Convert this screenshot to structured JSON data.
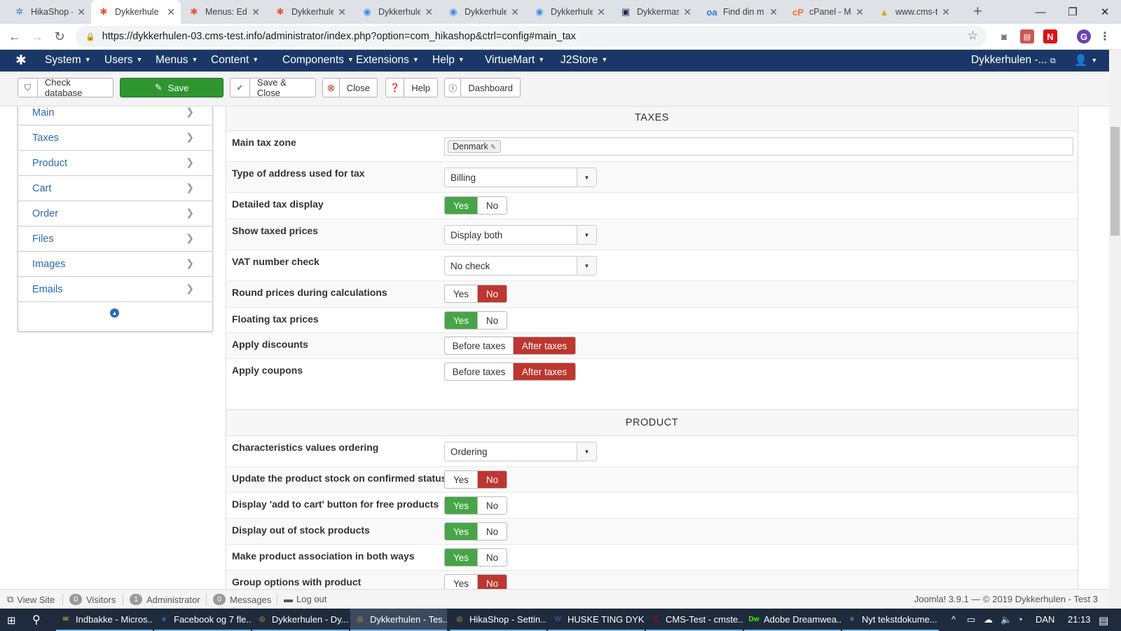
{
  "browser": {
    "tabs": [
      {
        "title": "HikaShop -",
        "icon": "hikashop-icon",
        "icon_glyph": "✲",
        "color": "#3a7bd5"
      },
      {
        "title": "Dykkerhule",
        "icon": "joomla-icon",
        "icon_glyph": "✱",
        "color": "#e8542f"
      },
      {
        "title": "Menus: Edi",
        "icon": "joomla-icon",
        "icon_glyph": "✱",
        "color": "#e8542f"
      },
      {
        "title": "Dykkerhule",
        "icon": "joomla-icon",
        "icon_glyph": "✱",
        "color": "#e8542f"
      },
      {
        "title": "Dykkerhule",
        "icon": "site-icon",
        "icon_glyph": "◉",
        "color": "#3a8ee6"
      },
      {
        "title": "Dykkerhule",
        "icon": "site-icon",
        "icon_glyph": "◉",
        "color": "#3a8ee6"
      },
      {
        "title": "Dykkerhule",
        "icon": "site-icon",
        "icon_glyph": "◉",
        "color": "#3a8ee6"
      },
      {
        "title": "Dykkermas",
        "icon": "site-icon",
        "icon_glyph": "▣",
        "color": "#1b2d4f"
      },
      {
        "title": "Find din m",
        "icon": "oa-icon",
        "icon_glyph": "oa",
        "color": "#2d7dd2"
      },
      {
        "title": "cPanel - M",
        "icon": "cpanel-icon",
        "icon_glyph": "cP",
        "color": "#ff6c2c"
      },
      {
        "title": "www.cms-t",
        "icon": "site-icon",
        "icon_glyph": "▲",
        "color": "#e0a020"
      }
    ],
    "url": "https://dykkerhulen-03.cms-test.info/administrator/index.php?option=com_hikashop&ctrl=config#main_tax",
    "profile_initial": "G"
  },
  "jnav": {
    "items": [
      "System",
      "Users",
      "Menus",
      "Content",
      "Components",
      "Extensions",
      "Help",
      "VirtueMart",
      "J2Store"
    ],
    "site_name": "Dykkerhulen -..."
  },
  "toolbar": {
    "check_db": "Check database",
    "save": "Save",
    "save_close": "Save & Close",
    "close": "Close",
    "help": "Help",
    "dashboard": "Dashboard"
  },
  "sidebar": {
    "items": [
      "Main",
      "Taxes",
      "Product",
      "Cart",
      "Order",
      "Files",
      "Images",
      "Emails"
    ]
  },
  "taxes": {
    "title": "TAXES",
    "main_tax_zone": {
      "label": "Main tax zone",
      "value": "Denmark"
    },
    "address_type": {
      "label": "Type of address used for tax",
      "value": "Billing"
    },
    "detailed_display": {
      "label": "Detailed tax display",
      "yes": "Yes",
      "no": "No",
      "selected": "yes"
    },
    "show_taxed": {
      "label": "Show taxed prices",
      "value": "Display both"
    },
    "vat_check": {
      "label": "VAT number check",
      "value": "No check"
    },
    "round_prices": {
      "label": "Round prices during calculations",
      "yes": "Yes",
      "no": "No",
      "selected": "no"
    },
    "floating": {
      "label": "Floating tax prices",
      "yes": "Yes",
      "no": "No",
      "selected": "yes"
    },
    "discounts": {
      "label": "Apply discounts",
      "before": "Before taxes",
      "after": "After taxes",
      "selected": "after"
    },
    "coupons": {
      "label": "Apply coupons",
      "before": "Before taxes",
      "after": "After taxes",
      "selected": "after"
    }
  },
  "product": {
    "title": "PRODUCT",
    "char_ordering": {
      "label": "Characteristics values ordering",
      "value": "Ordering"
    },
    "stock_confirmed": {
      "label": "Update the product stock on confirmed status",
      "yes": "Yes",
      "no": "No",
      "selected": "no"
    },
    "add_to_cart_free": {
      "label": "Display 'add to cart' button for free products",
      "yes": "Yes",
      "no": "No",
      "selected": "yes"
    },
    "out_of_stock": {
      "label": "Display out of stock products",
      "yes": "Yes",
      "no": "No",
      "selected": "yes"
    },
    "association": {
      "label": "Make product association in both ways",
      "yes": "Yes",
      "no": "No",
      "selected": "yes"
    },
    "group_options": {
      "label": "Group options with product",
      "yes": "Yes",
      "no": "No",
      "selected": "no"
    }
  },
  "status": {
    "view_site": "View Site",
    "visitors_count": "0",
    "visitors": "Visitors",
    "admin_count": "1",
    "admin": "Administrator",
    "messages_count": "0",
    "messages": "Messages",
    "logout": "Log out",
    "version": "Joomla! 3.9.1 — © 2019 Dykkerhulen - Test 3"
  },
  "taskbar": {
    "items": [
      {
        "label": "Indbakke - Micros...",
        "icon": "mail-icon",
        "glyph": "✉",
        "color": "#f2c12e"
      },
      {
        "label": "Facebook og 7 fle...",
        "icon": "edge-icon",
        "glyph": "e",
        "color": "#1e88e5"
      },
      {
        "label": "Dykkerhulen - Dy...",
        "icon": "chrome-icon",
        "glyph": "◎",
        "color": "#e9a93b"
      },
      {
        "label": "Dykkerhulen - Tes...",
        "icon": "chrome-icon",
        "glyph": "◎",
        "color": "#e9a93b"
      },
      {
        "label": "HikaShop - Settin...",
        "icon": "chrome-icon",
        "glyph": "◎",
        "color": "#e9a93b"
      },
      {
        "label": "HUSKE TING DYK...",
        "icon": "word-icon",
        "glyph": "W",
        "color": "#2b579a"
      },
      {
        "label": "CMS-Test - cmste...",
        "icon": "filezilla-icon",
        "glyph": "Z",
        "color": "#bf0000"
      },
      {
        "label": "Adobe Dreamwea...",
        "icon": "dreamweaver-icon",
        "glyph": "Dw",
        "color": "#35fa00"
      },
      {
        "label": "Nyt tekstdokume...",
        "icon": "notepad-icon",
        "glyph": "≡",
        "color": "#7fb2e5"
      }
    ],
    "lang": "DAN",
    "time": "21:13"
  }
}
